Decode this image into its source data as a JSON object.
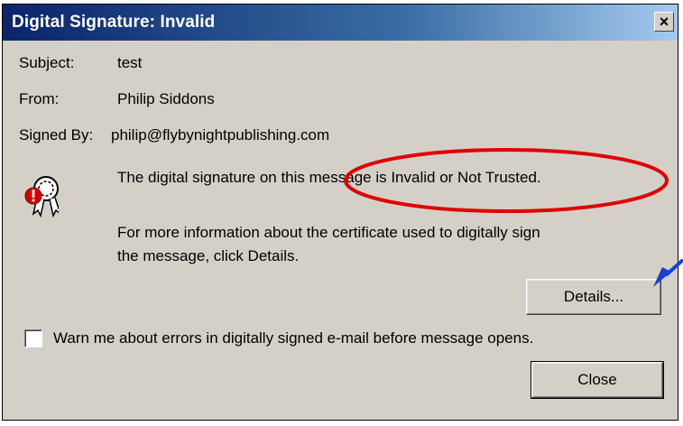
{
  "dialog": {
    "title": "Digital Signature: Invalid",
    "close_glyph": "×"
  },
  "fields": {
    "subject_label": "Subject:",
    "subject_value": "test",
    "from_label": "From:",
    "from_value": "Philip Siddons",
    "signed_by_label": "Signed By:",
    "signed_by_value": "philip@flybynightpublishing.com"
  },
  "messages": {
    "status": "The digital signature on this message is Invalid or Not Trusted.",
    "info_line1": "For more information about the certificate used to digitally sign",
    "info_line2": "the message, click Details."
  },
  "buttons": {
    "details_label": "Details...",
    "close_label": "Close"
  },
  "options": {
    "warn_label": "Warn me about errors in digitally signed e-mail before message opens.",
    "warn_checked": false
  },
  "icons": {
    "certificate": "certificate-error-icon",
    "annotation_circle": "red-ellipse-annotation",
    "annotation_arrow": "blue-arrow-annotation"
  },
  "colors": {
    "title_bar": "#0a246a",
    "dialog_bg": "#d4d0c8",
    "annotation_circle": "#e00000",
    "annotation_arrow": "#1a3fd6"
  }
}
